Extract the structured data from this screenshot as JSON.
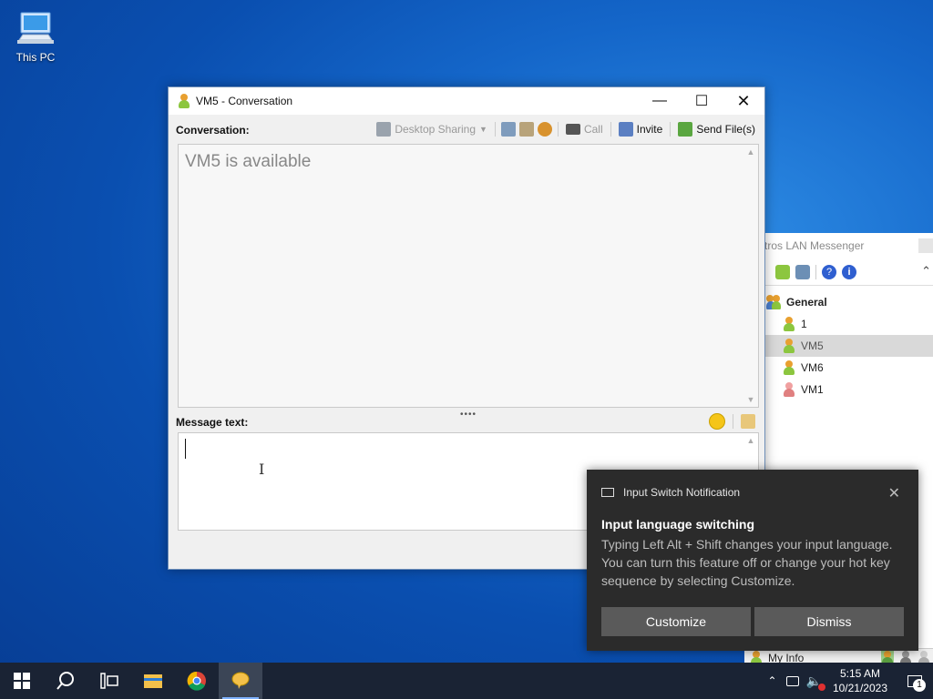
{
  "desktop": {
    "icons": [
      {
        "label": "This PC",
        "icon": "computer-icon"
      }
    ]
  },
  "messenger": {
    "title": "tros LAN Messenger",
    "group": "General",
    "users": [
      {
        "name": "1",
        "status_color": "#e8a030"
      },
      {
        "name": "VM5",
        "status_color": "#e8a030"
      },
      {
        "name": "VM6",
        "status_color": "#e8a030"
      },
      {
        "name": "VM1",
        "status_color": "#e08080"
      }
    ],
    "selected_user": "VM5",
    "status_label": "My Info"
  },
  "conversation": {
    "title": "VM5 - Conversation",
    "conversation_label": "Conversation:",
    "toolbar": {
      "desktop_sharing": "Desktop Sharing",
      "call": "Call",
      "invite": "Invite",
      "send_files": "Send File(s)"
    },
    "availability": "VM5 is available",
    "message_label": "Message text:",
    "message_value": ""
  },
  "toast": {
    "header": "Input Switch Notification",
    "title": "Input language switching",
    "body": "Typing Left Alt + Shift changes your input language. You can turn this feature off or change your hot key sequence by selecting Customize.",
    "customize": "Customize",
    "dismiss": "Dismiss"
  },
  "taskbar": {
    "time": "5:15 AM",
    "date": "10/21/2023",
    "notification_count": "1"
  },
  "colors": {
    "accent": "#0a59c4",
    "toast_bg": "#2b2b2b",
    "taskbar_bg": "#1a2334"
  }
}
